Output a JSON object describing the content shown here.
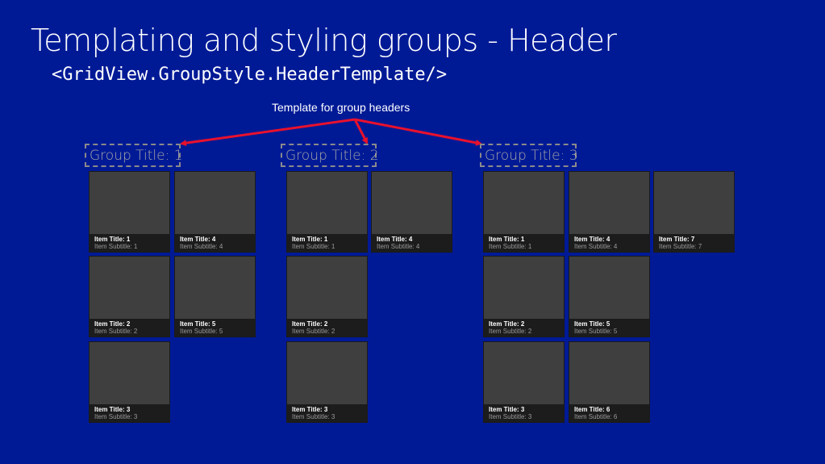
{
  "slide": {
    "title": "Templating and styling groups - Header",
    "subtitle": "<GridView.GroupStyle.HeaderTemplate/>",
    "callout": "Template for group headers"
  },
  "colors": {
    "background": "#001A96",
    "arrow": "#E8112D",
    "tile": "#3F3F3F",
    "caption": "#1C1C1C"
  },
  "groups": [
    {
      "header": "Group Title: 1",
      "items": [
        {
          "title": "Item Title: 1",
          "subtitle": "Item Subtitle: 1"
        },
        {
          "title": "Item Title: 2",
          "subtitle": "Item Subtitle: 2"
        },
        {
          "title": "Item Title: 3",
          "subtitle": "Item Subtitle: 3"
        },
        {
          "title": "Item Title: 4",
          "subtitle": "Item Subtitle: 4"
        },
        {
          "title": "Item Title: 5",
          "subtitle": "Item Subtitle: 5"
        }
      ]
    },
    {
      "header": "Group Title: 2",
      "items": [
        {
          "title": "Item Title: 1",
          "subtitle": "Item Subtitle: 1"
        },
        {
          "title": "Item Title: 2",
          "subtitle": "Item Subtitle: 2"
        },
        {
          "title": "Item Title: 3",
          "subtitle": "Item Subtitle: 3"
        },
        {
          "title": "Item Title: 4",
          "subtitle": "Item Subtitle: 4"
        }
      ]
    },
    {
      "header": "Group Title: 3",
      "items": [
        {
          "title": "Item Title: 1",
          "subtitle": "Item Subtitle: 1"
        },
        {
          "title": "Item Title: 2",
          "subtitle": "Item Subtitle: 2"
        },
        {
          "title": "Item Title: 3",
          "subtitle": "Item Subtitle: 3"
        },
        {
          "title": "Item Title: 4",
          "subtitle": "Item Subtitle: 4"
        },
        {
          "title": "Item Title: 5",
          "subtitle": "Item Subtitle: 5"
        },
        {
          "title": "Item Title: 6",
          "subtitle": "Item Subtitle: 6"
        },
        {
          "title": "Item Title: 7",
          "subtitle": "Item Subtitle: 7"
        }
      ]
    }
  ]
}
